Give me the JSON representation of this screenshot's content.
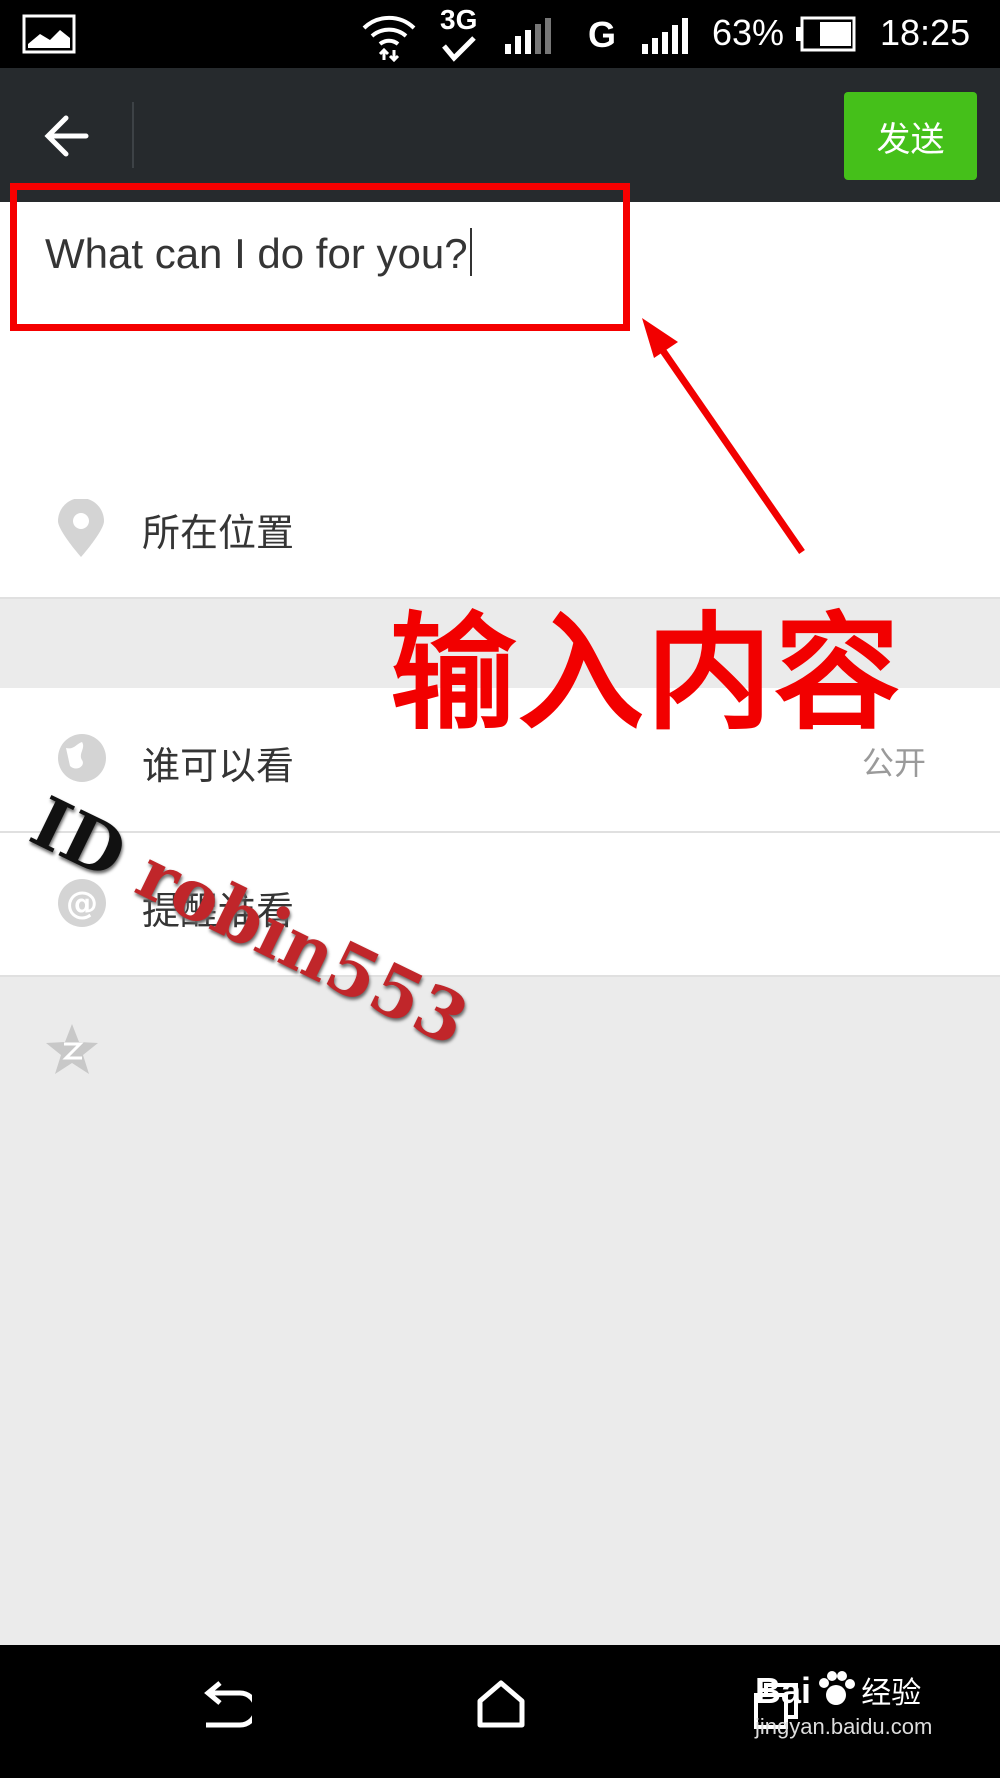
{
  "status_bar": {
    "network_label": "3G",
    "carrier_label": "G",
    "battery_percent": "63%",
    "time": "18:25"
  },
  "app_bar": {
    "back_icon": "arrow-left-icon",
    "send_label": "发送",
    "send_color": "#45c01a"
  },
  "compose": {
    "text_value": "What can I do for you?"
  },
  "options": {
    "location_label": "所在位置",
    "visibility_label": "谁可以看",
    "visibility_value": "公开",
    "mention_label": "提醒谁看"
  },
  "annotation": {
    "callout_text": "输入内容",
    "color": "#f20000"
  },
  "watermark": {
    "id_text": "ID",
    "user_text": "robin553"
  },
  "branding": {
    "brand_text": "Bai",
    "brand_suffix": "经验",
    "url_text": "jingyan.baidu.com"
  }
}
